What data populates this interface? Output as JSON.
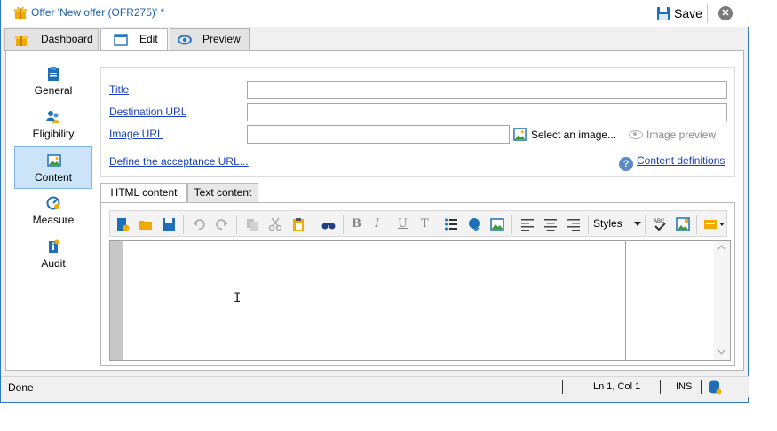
{
  "window": {
    "title": "Offer 'New offer (OFR275)' *",
    "save_label": "Save",
    "close_glyph": "✕"
  },
  "tabs": [
    {
      "label": "Dashboard",
      "icon": "gift-icon"
    },
    {
      "label": "Edit",
      "icon": "window-edit-icon",
      "active": true
    },
    {
      "label": "Preview",
      "icon": "eye-icon"
    }
  ],
  "sidebar": {
    "items": [
      {
        "label": "General",
        "icon": "clipboard-icon"
      },
      {
        "label": "Eligibility",
        "icon": "users-icon"
      },
      {
        "label": "Content",
        "icon": "image-icon",
        "active": true
      },
      {
        "label": "Measure",
        "icon": "gauge-icon"
      },
      {
        "label": "Audit",
        "icon": "info-icon"
      }
    ]
  },
  "form": {
    "title_label": "Title",
    "title_value": "",
    "destination_label": "Destination URL",
    "destination_value": "",
    "image_label": "Image URL",
    "image_value": "",
    "select_image": "Select an image...",
    "image_preview": "Image preview",
    "acceptance_url": "Define the acceptance URL...",
    "content_definitions": "Content definitions"
  },
  "editor": {
    "tabs": [
      {
        "label": "HTML content",
        "active": true
      },
      {
        "label": "Text content"
      }
    ],
    "styles_label": "Styles"
  },
  "status": {
    "left": "Done",
    "position": "Ln 1, Col 1",
    "mode": "INS"
  },
  "colors": {
    "accent": "#2b79c2",
    "link": "#1a3fbf",
    "active_nav_bg": "#cce4f7"
  }
}
